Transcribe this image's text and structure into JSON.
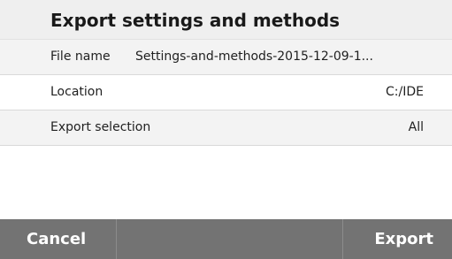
{
  "dialog": {
    "title": "Export settings and methods",
    "rows": [
      {
        "label": "File name",
        "value": "Settings-and-methods-2015-12-09-1..."
      },
      {
        "label": "Location",
        "value": "C:/IDE"
      },
      {
        "label": "Export selection",
        "value": "All"
      }
    ]
  },
  "footer": {
    "cancel_label": "Cancel",
    "export_label": "Export"
  },
  "colors": {
    "title_background": "#efefef",
    "footer_background": "#737373",
    "button_text": "#ffffff"
  }
}
